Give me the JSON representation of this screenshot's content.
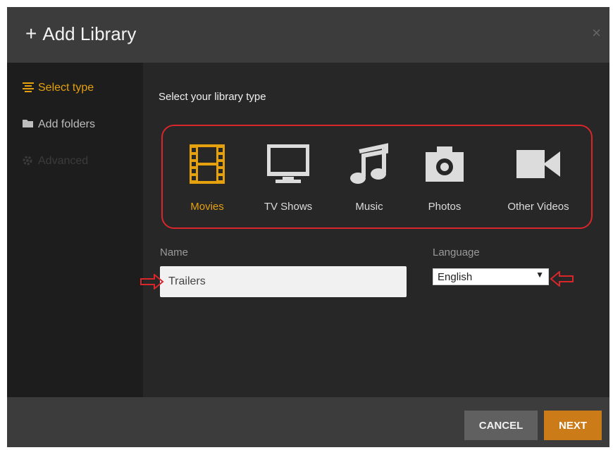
{
  "dialog": {
    "title": "Add Library",
    "title_icon": "plus-icon",
    "close_glyph": "×"
  },
  "sidebar": {
    "items": [
      {
        "label": "Select type",
        "icon": "list-icon",
        "state": "active"
      },
      {
        "label": "Add folders",
        "icon": "folder-icon",
        "state": "normal"
      },
      {
        "label": "Advanced",
        "icon": "gear-icon",
        "state": "disabled"
      }
    ]
  },
  "main": {
    "heading": "Select your library type",
    "types": [
      {
        "label": "Movies",
        "icon": "film-icon",
        "selected": true
      },
      {
        "label": "TV Shows",
        "icon": "tv-icon",
        "selected": false
      },
      {
        "label": "Music",
        "icon": "music-icon",
        "selected": false
      },
      {
        "label": "Photos",
        "icon": "camera-icon",
        "selected": false
      },
      {
        "label": "Other Videos",
        "icon": "video-camera-icon",
        "selected": false
      }
    ],
    "name_label": "Name",
    "name_value": "Trailers",
    "language_label": "Language",
    "language_value": "English"
  },
  "footer": {
    "cancel_label": "CANCEL",
    "next_label": "NEXT"
  },
  "colors": {
    "accent": "#e5a00d",
    "next_button": "#cc7b19",
    "highlight_red": "#d8262b"
  }
}
